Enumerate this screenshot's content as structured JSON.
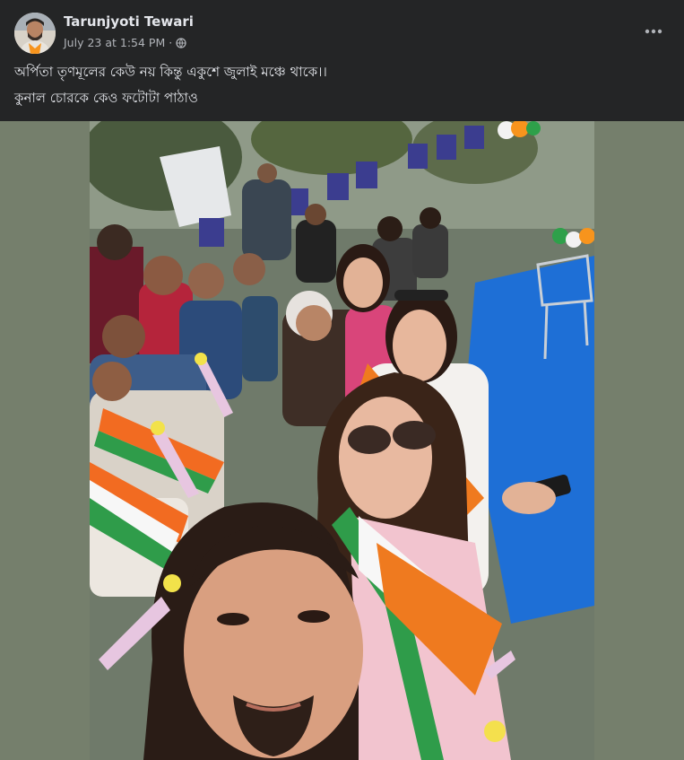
{
  "post": {
    "author": "Tarunjyoti Tewari",
    "timestamp": "July 23 at 1:54 PM",
    "separator": "·",
    "privacy_icon": "globe-icon",
    "more_icon": "more-horizontal-icon",
    "caption_lines": [
      "অর্পিতা তৃণমূলের কেউ নয় কিন্তু একুশে জুলাই মঞ্চে থাকে।।",
      "কুনাল চোরকে কেও ফটোটা পাঠাও"
    ]
  },
  "colors": {
    "background": "#242526",
    "text_primary": "#e4e6eb",
    "text_secondary": "#b0b3b8",
    "photo_letterbox": "#757f6c",
    "stage_floor": "#1e6fd6"
  }
}
